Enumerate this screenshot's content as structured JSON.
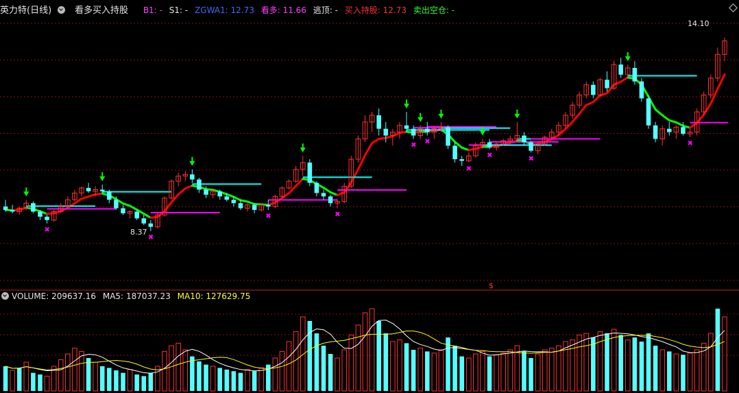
{
  "header": {
    "stock": "英力特(日线)",
    "indicator": "看多买入持股",
    "b1_label": "B1:",
    "b1_value": "-",
    "s1_label": "S1:",
    "s1_value": "-",
    "zgwa_label": "ZGWA1:",
    "zgwa_value": "12.73",
    "kanduo_label": "看多:",
    "kanduo_value": "11.66",
    "taoding_label": "逃顶:",
    "taoding_value": "-",
    "mairu_label": "买入持股:",
    "mairu_value": "12.73",
    "maichu_label": "卖出空仓:",
    "maichu_value": "-"
  },
  "volume_header": {
    "volume_label": "VOLUME:",
    "volume_value": "209637.16",
    "ma5_label": "MA5:",
    "ma5_value": "187037.23",
    "ma10_label": "MA10:",
    "ma10_value": "127629.75"
  },
  "annotations": {
    "high": "14.10",
    "low": "8.37",
    "dollar": "$"
  },
  "colors": {
    "up": "#ff3232",
    "down": "#54ffff",
    "green_line": "#00ff00",
    "red_line": "#ff0000",
    "magenta": "#ff00ff",
    "cyan_line": "#00ffff",
    "blue": "#3030ff",
    "grid": "#801010",
    "ma5": "#ffffff",
    "ma10": "#ffff00"
  },
  "chart_data": {
    "type": "candlestick",
    "price_range": [
      7.5,
      14.6
    ],
    "grid": true,
    "candles": [
      [
        9.1,
        9.3,
        8.95,
        9.0
      ],
      [
        9.0,
        9.15,
        8.9,
        8.95
      ],
      [
        8.95,
        9.1,
        8.85,
        9.05
      ],
      [
        9.05,
        9.3,
        9.0,
        9.2
      ],
      [
        9.2,
        9.25,
        8.9,
        8.95
      ],
      [
        8.95,
        9.0,
        8.7,
        8.8
      ],
      [
        8.8,
        8.85,
        8.6,
        8.7
      ],
      [
        8.7,
        9.0,
        8.65,
        8.95
      ],
      [
        8.95,
        9.2,
        8.9,
        9.1
      ],
      [
        9.1,
        9.4,
        9.05,
        9.3
      ],
      [
        9.3,
        9.6,
        9.25,
        9.5
      ],
      [
        9.5,
        9.7,
        9.4,
        9.65
      ],
      [
        9.65,
        9.8,
        9.5,
        9.55
      ],
      [
        9.55,
        9.7,
        9.4,
        9.6
      ],
      [
        9.6,
        9.75,
        9.5,
        9.55
      ],
      [
        9.55,
        9.6,
        9.2,
        9.3
      ],
      [
        9.3,
        9.4,
        9.0,
        9.05
      ],
      [
        9.05,
        9.15,
        8.85,
        8.9
      ],
      [
        8.9,
        9.0,
        8.75,
        8.95
      ],
      [
        8.95,
        9.0,
        8.7,
        8.75
      ],
      [
        8.75,
        8.85,
        8.55,
        8.6
      ],
      [
        8.6,
        8.7,
        8.37,
        8.5
      ],
      [
        8.5,
        8.9,
        8.45,
        8.85
      ],
      [
        8.85,
        9.4,
        8.8,
        9.35
      ],
      [
        9.35,
        9.9,
        9.3,
        9.85
      ],
      [
        9.85,
        10.1,
        9.7,
        10.0
      ],
      [
        10.0,
        10.15,
        9.85,
        10.05
      ],
      [
        10.05,
        10.2,
        9.8,
        9.9
      ],
      [
        9.9,
        9.95,
        9.5,
        9.6
      ],
      [
        9.6,
        9.7,
        9.35,
        9.45
      ],
      [
        9.45,
        9.6,
        9.35,
        9.55
      ],
      [
        9.55,
        9.6,
        9.3,
        9.4
      ],
      [
        9.4,
        9.5,
        9.25,
        9.3
      ],
      [
        9.3,
        9.4,
        9.1,
        9.2
      ],
      [
        9.2,
        9.3,
        9.0,
        9.05
      ],
      [
        9.05,
        9.2,
        8.95,
        9.15
      ],
      [
        9.15,
        9.2,
        8.9,
        9.0
      ],
      [
        9.0,
        9.2,
        8.95,
        9.15
      ],
      [
        9.15,
        9.3,
        9.0,
        9.1
      ],
      [
        9.1,
        9.45,
        9.05,
        9.4
      ],
      [
        9.4,
        9.7,
        9.35,
        9.65
      ],
      [
        9.65,
        9.9,
        9.6,
        9.85
      ],
      [
        9.85,
        10.3,
        9.8,
        10.2
      ],
      [
        10.2,
        10.6,
        10.0,
        10.4
      ],
      [
        10.4,
        10.5,
        9.7,
        9.8
      ],
      [
        9.8,
        9.85,
        9.4,
        9.5
      ],
      [
        9.5,
        9.6,
        9.3,
        9.4
      ],
      [
        9.4,
        9.45,
        9.1,
        9.2
      ],
      [
        9.2,
        9.3,
        9.05,
        9.25
      ],
      [
        9.25,
        9.8,
        9.2,
        9.7
      ],
      [
        9.7,
        10.6,
        9.65,
        10.5
      ],
      [
        10.5,
        11.2,
        10.4,
        11.1
      ],
      [
        11.1,
        11.8,
        11.0,
        11.6
      ],
      [
        11.6,
        11.9,
        11.3,
        11.8
      ],
      [
        11.8,
        12.0,
        11.2,
        11.4
      ],
      [
        11.4,
        11.6,
        11.0,
        11.2
      ],
      [
        11.2,
        11.4,
        10.9,
        11.3
      ],
      [
        11.3,
        11.6,
        11.1,
        11.5
      ],
      [
        11.5,
        11.9,
        11.3,
        11.4
      ],
      [
        11.4,
        11.5,
        11.1,
        11.2
      ],
      [
        11.2,
        11.5,
        11.1,
        11.4
      ],
      [
        11.4,
        11.6,
        11.2,
        11.3
      ],
      [
        11.3,
        11.5,
        11.1,
        11.4
      ],
      [
        11.4,
        11.6,
        11.3,
        11.45
      ],
      [
        11.45,
        11.5,
        10.8,
        10.9
      ],
      [
        10.9,
        11.0,
        10.4,
        10.5
      ],
      [
        10.5,
        10.6,
        10.3,
        10.45
      ],
      [
        10.45,
        10.7,
        10.4,
        10.6
      ],
      [
        10.6,
        11.0,
        10.55,
        10.9
      ],
      [
        10.9,
        11.1,
        10.8,
        11.0
      ],
      [
        11.0,
        11.1,
        10.8,
        10.85
      ],
      [
        10.85,
        11.0,
        10.75,
        10.95
      ],
      [
        10.95,
        11.1,
        10.9,
        11.05
      ],
      [
        11.05,
        11.2,
        10.95,
        11.1
      ],
      [
        11.1,
        11.6,
        11.05,
        11.2
      ],
      [
        11.2,
        11.3,
        10.9,
        11.0
      ],
      [
        11.0,
        11.05,
        10.7,
        10.75
      ],
      [
        10.75,
        11.0,
        10.65,
        10.95
      ],
      [
        10.95,
        11.2,
        10.9,
        11.15
      ],
      [
        11.15,
        11.4,
        11.1,
        11.3
      ],
      [
        11.3,
        11.6,
        11.2,
        11.5
      ],
      [
        11.5,
        11.9,
        11.4,
        11.8
      ],
      [
        11.8,
        12.2,
        11.7,
        12.1
      ],
      [
        12.1,
        12.5,
        12.0,
        12.4
      ],
      [
        12.4,
        12.8,
        12.3,
        12.7
      ],
      [
        12.7,
        12.8,
        12.3,
        12.4
      ],
      [
        12.4,
        12.9,
        12.35,
        12.85
      ],
      [
        12.85,
        13.1,
        12.5,
        12.6
      ],
      [
        12.6,
        13.4,
        12.55,
        13.3
      ],
      [
        13.3,
        13.5,
        12.9,
        13.0
      ],
      [
        13.0,
        13.3,
        12.9,
        13.2
      ],
      [
        13.2,
        13.4,
        12.7,
        12.8
      ],
      [
        12.8,
        12.9,
        12.2,
        12.3
      ],
      [
        12.3,
        12.4,
        11.4,
        11.5
      ],
      [
        11.5,
        11.6,
        11.0,
        11.1
      ],
      [
        11.1,
        11.5,
        10.9,
        11.4
      ],
      [
        11.4,
        11.6,
        11.2,
        11.3
      ],
      [
        11.3,
        11.5,
        11.1,
        11.45
      ],
      [
        11.45,
        11.6,
        11.2,
        11.25
      ],
      [
        11.25,
        11.4,
        11.15,
        11.3
      ],
      [
        11.3,
        12.0,
        11.2,
        11.9
      ],
      [
        11.9,
        12.5,
        11.8,
        12.4
      ],
      [
        12.4,
        13.0,
        12.3,
        12.9
      ],
      [
        12.9,
        13.8,
        12.8,
        13.6
      ],
      [
        13.6,
        14.1,
        13.4,
        14.0
      ]
    ],
    "volumes": [
      30,
      25,
      28,
      35,
      22,
      20,
      18,
      30,
      38,
      45,
      52,
      48,
      40,
      35,
      30,
      28,
      25,
      22,
      26,
      20,
      18,
      22,
      30,
      48,
      55,
      58,
      50,
      42,
      36,
      32,
      30,
      28,
      26,
      24,
      22,
      26,
      24,
      28,
      32,
      40,
      48,
      60,
      72,
      90,
      85,
      70,
      55,
      45,
      40,
      50,
      68,
      80,
      95,
      100,
      85,
      70,
      60,
      62,
      58,
      50,
      52,
      48,
      46,
      50,
      65,
      55,
      42,
      40,
      45,
      48,
      42,
      44,
      46,
      50,
      55,
      48,
      40,
      45,
      50,
      52,
      55,
      60,
      62,
      68,
      70,
      65,
      72,
      70,
      75,
      68,
      62,
      65,
      60,
      70,
      55,
      50,
      48,
      45,
      44,
      46,
      50,
      58,
      70,
      100,
      90
    ],
    "volume_up": [
      false,
      true,
      false,
      true,
      false,
      false,
      true,
      true,
      true,
      true,
      true,
      true,
      false,
      true,
      false,
      false,
      false,
      false,
      true,
      false,
      false,
      false,
      true,
      true,
      true,
      true,
      true,
      false,
      false,
      false,
      true,
      false,
      false,
      false,
      false,
      true,
      false,
      true,
      false,
      true,
      true,
      true,
      true,
      true,
      false,
      false,
      false,
      false,
      true,
      true,
      true,
      true,
      true,
      true,
      false,
      false,
      true,
      true,
      false,
      false,
      true,
      false,
      true,
      true,
      false,
      false,
      false,
      true,
      true,
      true,
      false,
      true,
      true,
      true,
      true,
      false,
      false,
      true,
      true,
      true,
      true,
      true,
      true,
      true,
      true,
      false,
      true,
      false,
      true,
      false,
      true,
      false,
      false,
      false,
      false,
      true,
      false,
      true,
      false,
      true,
      true,
      true,
      true,
      false,
      true
    ]
  }
}
